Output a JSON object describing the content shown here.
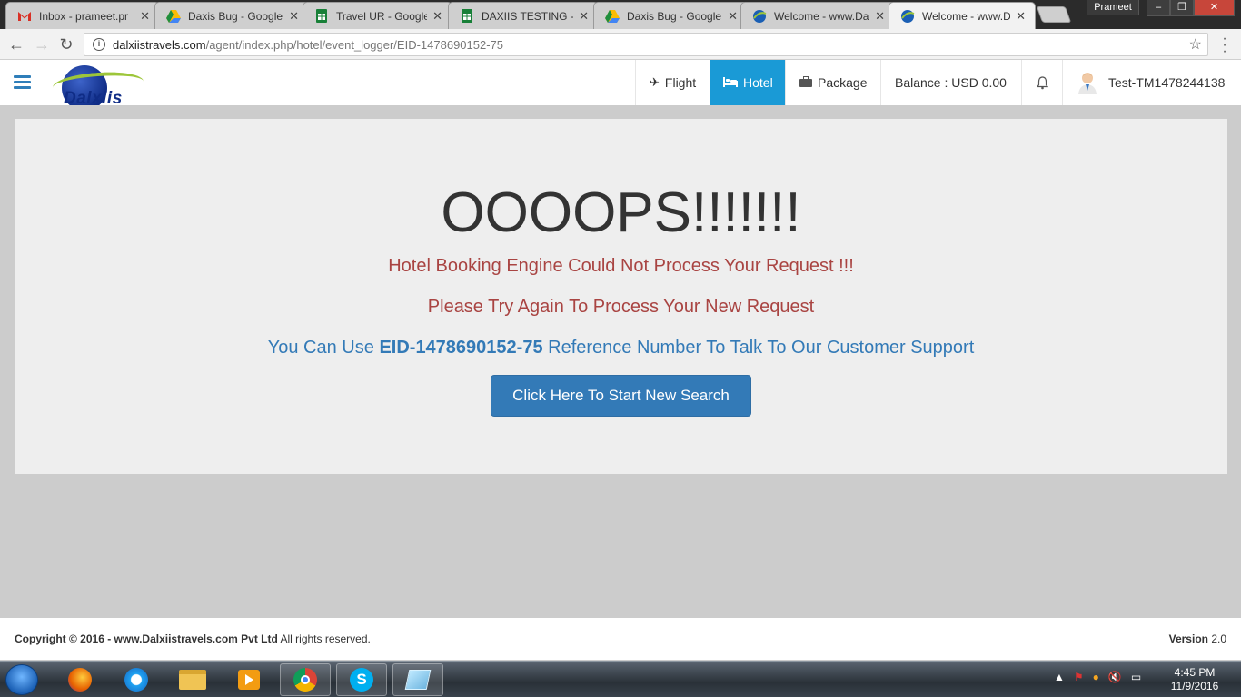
{
  "browser": {
    "tabs": [
      {
        "title": "Inbox - prameet.pr",
        "icon": "gmail-icon",
        "color": "#d93025"
      },
      {
        "title": "Daxis Bug - Google",
        "icon": "drive-icon",
        "color": "#1e8e3e"
      },
      {
        "title": "Travel UR - Google",
        "icon": "sheets-icon",
        "color": "#188038"
      },
      {
        "title": "DAXIIS TESTING - G",
        "icon": "sheets-icon",
        "color": "#188038"
      },
      {
        "title": "Daxis Bug - Google",
        "icon": "drive-icon",
        "color": "#1e8e3e"
      },
      {
        "title": "Welcome - www.Da",
        "icon": "daxiis-icon",
        "color": "#1a9ad6"
      },
      {
        "title": "Welcome - www.Da",
        "icon": "daxiis-icon",
        "color": "#1a9ad6"
      }
    ],
    "profile_name": "Prameet",
    "url_host": "dalxiistravels.com",
    "url_path": "/agent/index.php/hotel/event_logger/EID-1478690152-75"
  },
  "site": {
    "logo_text": "Dalxiis",
    "nav": {
      "flight": "Flight",
      "hotel": "Hotel",
      "package": "Package",
      "balance": "Balance : USD 0.00",
      "user": "Test-TM1478244138"
    },
    "accent_color": "#1a9ad6"
  },
  "error": {
    "heading": "OOOOPS!!!!!!!",
    "line1": "Hotel Booking Engine Could Not Process Your Request !!!",
    "line2": "Please Try Again To Process Your New Request",
    "line3_prefix": "You Can Use ",
    "line3_ref": "EID-1478690152-75",
    "line3_suffix": " Reference Number To Talk To Our Customer Support",
    "button": "Click Here To Start New Search"
  },
  "footer": {
    "copyright_bold": "Copyright © 2016 - www.Dalxiistravels.com Pvt Ltd",
    "copyright_rest": " All rights reserved.",
    "version_label": "Version",
    "version_value": " 2.0"
  },
  "taskbar": {
    "time": "4:45 PM",
    "date": "11/9/2016",
    "apps": [
      "firefox-icon",
      "ie-icon",
      "explorer-icon",
      "media-player-icon",
      "chrome-icon",
      "skype-icon",
      "notes-icon"
    ]
  }
}
